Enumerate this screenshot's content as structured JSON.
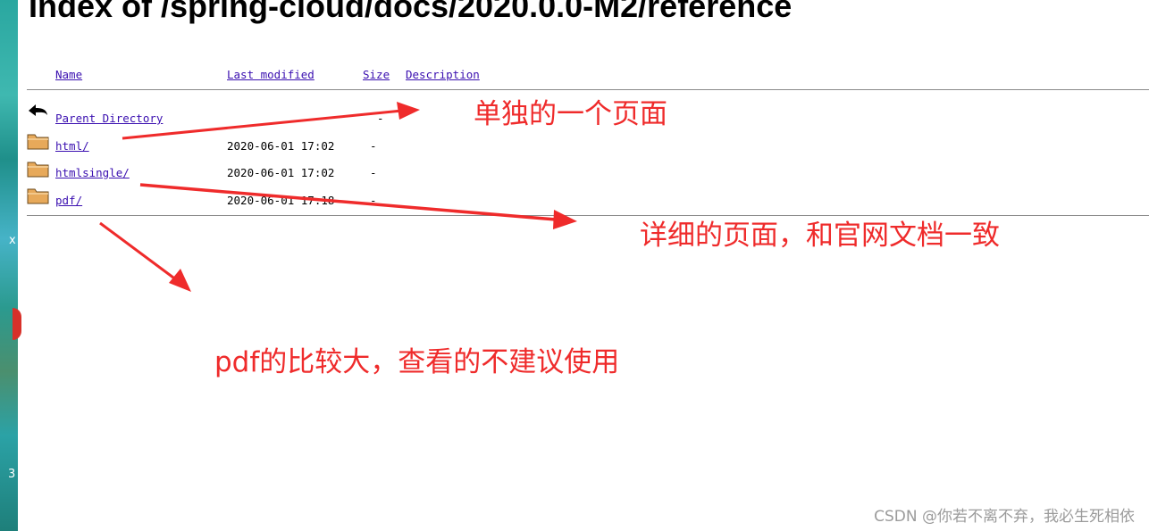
{
  "desktop": {
    "strip_marks": [
      "x",
      "3"
    ]
  },
  "page": {
    "title": "Index of /spring-cloud/docs/2020.0.0-M2/reference",
    "columns": {
      "name": "Name",
      "last_modified": "Last modified",
      "size": "Size",
      "description": "Description"
    }
  },
  "rows": [
    {
      "icon": "back-arrow-icon",
      "name": "Parent Directory",
      "modified": "",
      "size": "-"
    },
    {
      "icon": "folder-icon",
      "name": "html/",
      "modified": "2020-06-01 17:02",
      "size": "-"
    },
    {
      "icon": "folder-icon",
      "name": "htmlsingle/",
      "modified": "2020-06-01 17:02",
      "size": "-"
    },
    {
      "icon": "folder-icon",
      "name": "pdf/",
      "modified": "2020-06-01 17:18",
      "size": "-"
    }
  ],
  "annotations": {
    "single_page": "单独的一个页面",
    "detailed_page": "详细的页面，和官网文档一致",
    "pdf_note": "pdf的比较大，查看的不建议使用",
    "color": "#ef2b2b"
  },
  "watermark": "CSDN @你若不离不弃，我必生死相依"
}
